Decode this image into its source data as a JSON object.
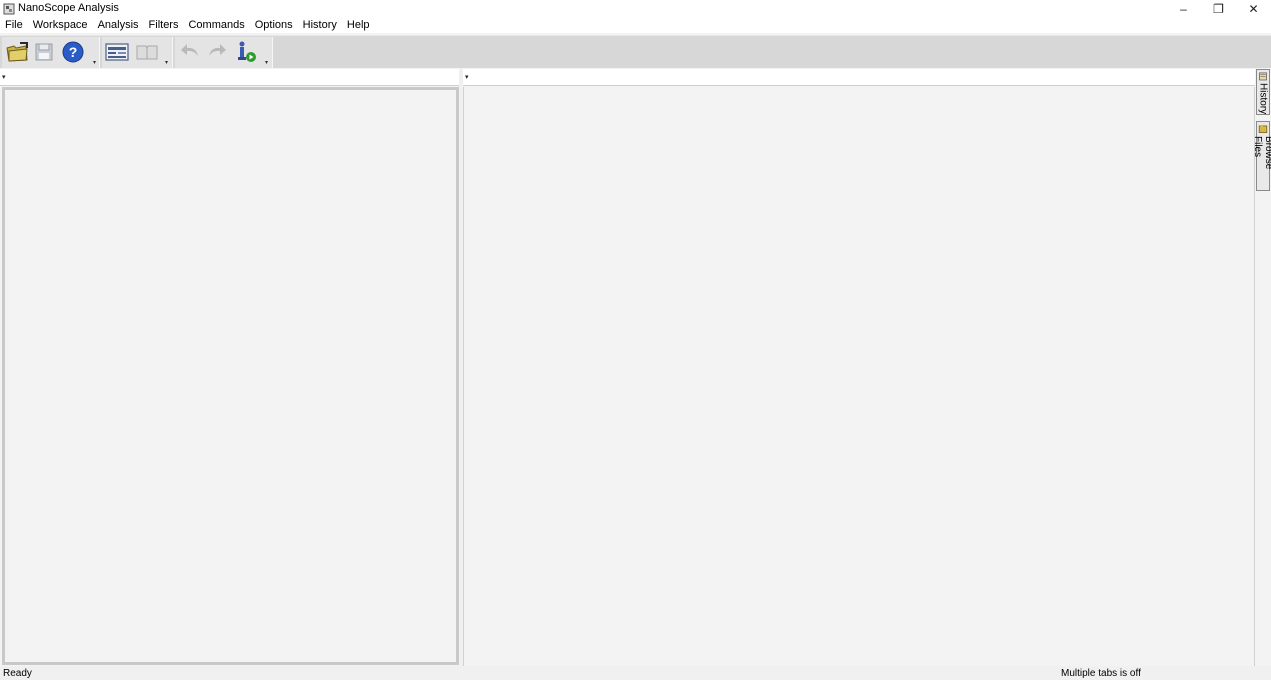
{
  "window": {
    "title": "NanoScope Analysis",
    "minimize": "–",
    "restore": "❐",
    "close": "✕"
  },
  "menu": [
    "File",
    "Workspace",
    "Analysis",
    "Filters",
    "Commands",
    "Options",
    "History",
    "Help"
  ],
  "toolbar": {
    "icons": [
      "open-folder-icon",
      "save-icon",
      "help-icon",
      "view-toggle-icon",
      "book-icon",
      "undo-icon",
      "redo-icon",
      "run-script-icon"
    ],
    "dropdown_glyph": "▾"
  },
  "panels": {
    "left_header_arrow": "▾",
    "right_header_arrow": "▾"
  },
  "side_tabs": {
    "history": "History",
    "browse_files": "Browse Files"
  },
  "status": {
    "left": "Ready",
    "right": "Multiple tabs is off"
  },
  "colors": {
    "toolbar_bg": "#d7d7d7",
    "panel_bg": "#f3f3f3",
    "help_blue": "#2a5cc8",
    "folder_yellow": "#c8b24a"
  }
}
